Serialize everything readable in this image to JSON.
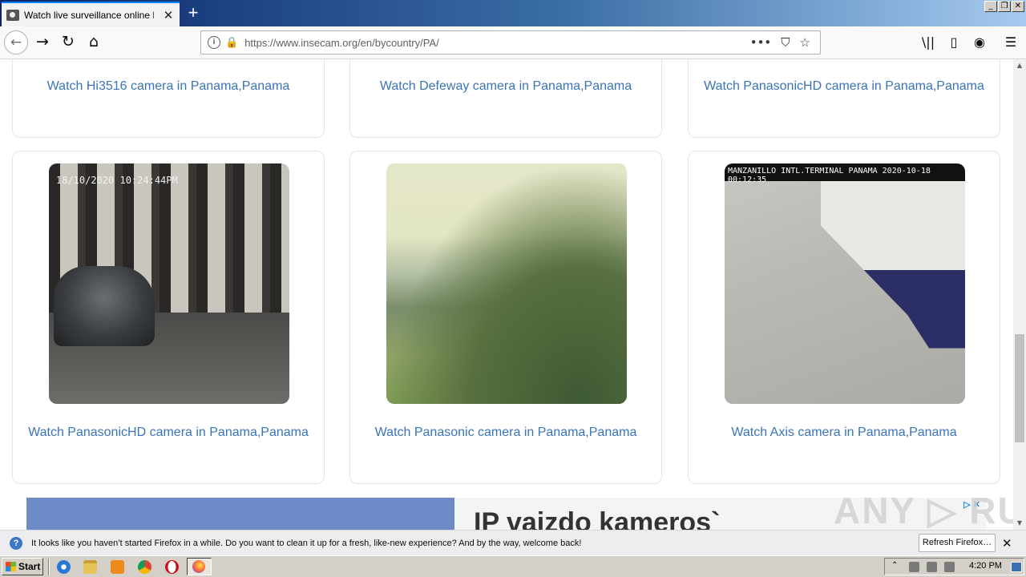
{
  "browser": {
    "tab_title": "Watch live surveillance online IP ca",
    "url": "https://www.insecam.org/en/bycountry/PA/",
    "new_tab_symbol": "+",
    "tab_close_symbol": "✕"
  },
  "window_controls": {
    "minimize": "_",
    "restore": "❐",
    "close": "✕"
  },
  "toolbar": {
    "back": "←",
    "forward": "→",
    "reload": "↻",
    "home": "⌂",
    "library": "\\||",
    "sidebar": "▯",
    "account": "◉",
    "menu": "☰",
    "page_actions": "•••",
    "pocket": "⛉",
    "bookmark": "☆"
  },
  "cameras": [
    {
      "link": "Watch Hi3516 camera in Panama,Panama"
    },
    {
      "link": "Watch Defeway camera in Panama,Panama"
    },
    {
      "link": "Watch PanasonicHD camera in Panama,Panama"
    },
    {
      "link": "Watch PanasonicHD camera in Panama,Panama",
      "overlay": "18/10/2020  10:24:44PM"
    },
    {
      "link": "Watch Panasonic camera in Panama,Panama"
    },
    {
      "link": "Watch Axis camera in Panama,Panama",
      "overlay": "MANZANILLO INTL.TERMINAL PANAMA 2020-10-18 00:12:35"
    }
  ],
  "ad": {
    "headline": "IP vaizdo kameros`",
    "choices": "▷ ✕"
  },
  "watermark": "ANY ▷ RUN",
  "scrollbar": {
    "up": "▲",
    "down": "▼"
  },
  "notification": {
    "text": "It looks like you haven’t started Firefox in a while. Do you want to clean it up for a fresh, like-new experience? And by the way, welcome back!",
    "button": "Refresh Firefox…",
    "close": "✕",
    "icon": "?"
  },
  "taskbar": {
    "start": "Start",
    "clock": "4:20 PM",
    "tray_chevron": "⌃"
  }
}
